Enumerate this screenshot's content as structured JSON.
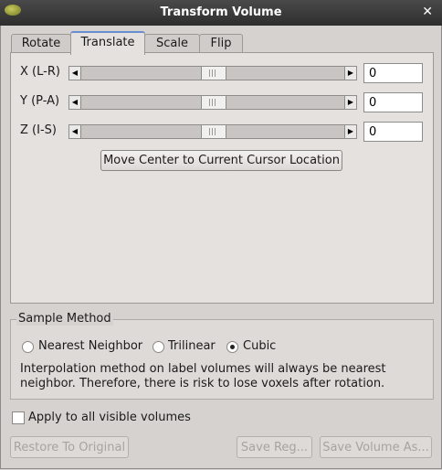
{
  "window": {
    "title": "Transform Volume",
    "close_glyph": "✕",
    "app_icon": "freeview-brain-icon"
  },
  "tabs": [
    {
      "label": "Rotate",
      "active": false
    },
    {
      "label": "Translate",
      "active": true
    },
    {
      "label": "Scale",
      "active": false
    },
    {
      "label": "Flip",
      "active": false
    }
  ],
  "translate": {
    "rows": [
      {
        "label": "X (L-R)",
        "value": "0"
      },
      {
        "label": "Y (P-A)",
        "value": "0"
      },
      {
        "label": "Z (I-S)",
        "value": "0"
      }
    ],
    "move_center_label": "Move Center to Current Cursor Location"
  },
  "sample_method": {
    "title": "Sample Method",
    "options": [
      {
        "label": "Nearest Neighbor",
        "checked": false
      },
      {
        "label": "Trilinear",
        "checked": false
      },
      {
        "label": "Cubic",
        "checked": true
      }
    ],
    "note": "Interpolation method on label volumes will always be nearest neighbor. Therefore, there is risk to lose voxels after rotation."
  },
  "apply_all": {
    "label": "Apply to all visible volumes",
    "checked": false
  },
  "buttons": {
    "restore": "Restore To Original",
    "save_reg": "Save Reg...",
    "save_volume": "Save Volume As..."
  }
}
